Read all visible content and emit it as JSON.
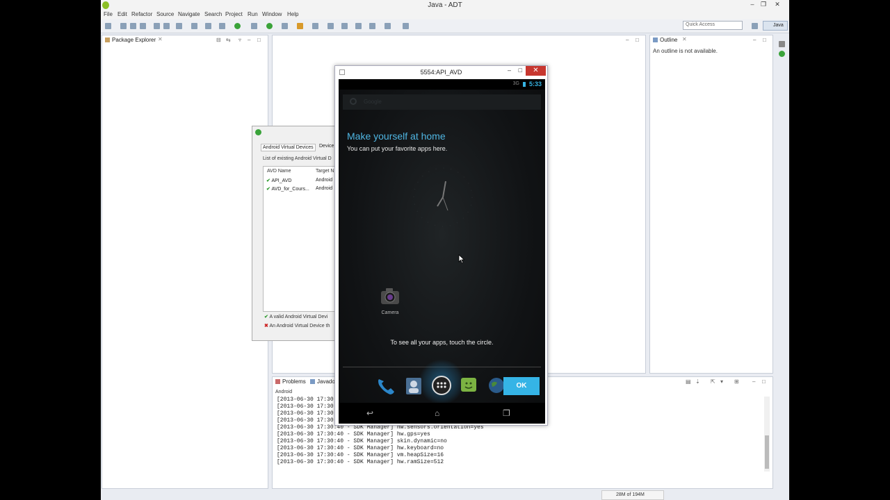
{
  "window": {
    "title": "Java - ADT"
  },
  "menu": [
    "File",
    "Edit",
    "Refactor",
    "Source",
    "Navigate",
    "Search",
    "Project",
    "Run",
    "Window",
    "Help"
  ],
  "toolbar": {
    "quick_access_placeholder": "Quick Access",
    "perspective": "Java"
  },
  "package_explorer": {
    "title": "Package Explorer"
  },
  "outline": {
    "title": "Outline",
    "message": "An outline is not available."
  },
  "avd_manager": {
    "tabs": [
      "Android Virtual Devices",
      "Device"
    ],
    "list_caption": "List of existing Android Virtual D",
    "columns": [
      "AVD Name",
      "Target N"
    ],
    "rows": [
      {
        "name": "API_AVD",
        "target": "Android"
      },
      {
        "name": "AVD_for_Cours...",
        "target": "Android"
      }
    ],
    "legend_valid": "A valid Android Virtual Devi",
    "legend_invalid": "An Android Virtual Device th"
  },
  "console": {
    "tabs": [
      "Problems",
      "Javado"
    ],
    "label": "Android",
    "lines": [
      "[2013-06-30 17:30:",
      "[2013-06-30 17:30:",
      "[2013-06-30 17:30:",
      "[2013-06-30 17:30:",
      "[2013-06-30 17:30:40 - SDK Manager] hw.sensors.orientation=yes",
      "[2013-06-30 17:30:40 - SDK Manager] hw.gps=yes",
      "[2013-06-30 17:30:40 - SDK Manager] skin.dynamic=no",
      "[2013-06-30 17:30:40 - SDK Manager] hw.keyboard=no",
      "[2013-06-30 17:30:40 - SDK Manager] vm.heapSize=16",
      "[2013-06-30 17:30:40 - SDK Manager] hw.ramSize=512"
    ]
  },
  "emulator": {
    "title": "5554:API_AVD",
    "clock": "5:33",
    "network": "3G",
    "search_hint": "Google",
    "headline": "Make yourself at home",
    "subline": "You can put your favorite apps here.",
    "camera_label": "Camera",
    "tip": "To see all your apps, touch the circle.",
    "ok_label": "OK"
  },
  "heap": {
    "status": "28M of 194M"
  }
}
